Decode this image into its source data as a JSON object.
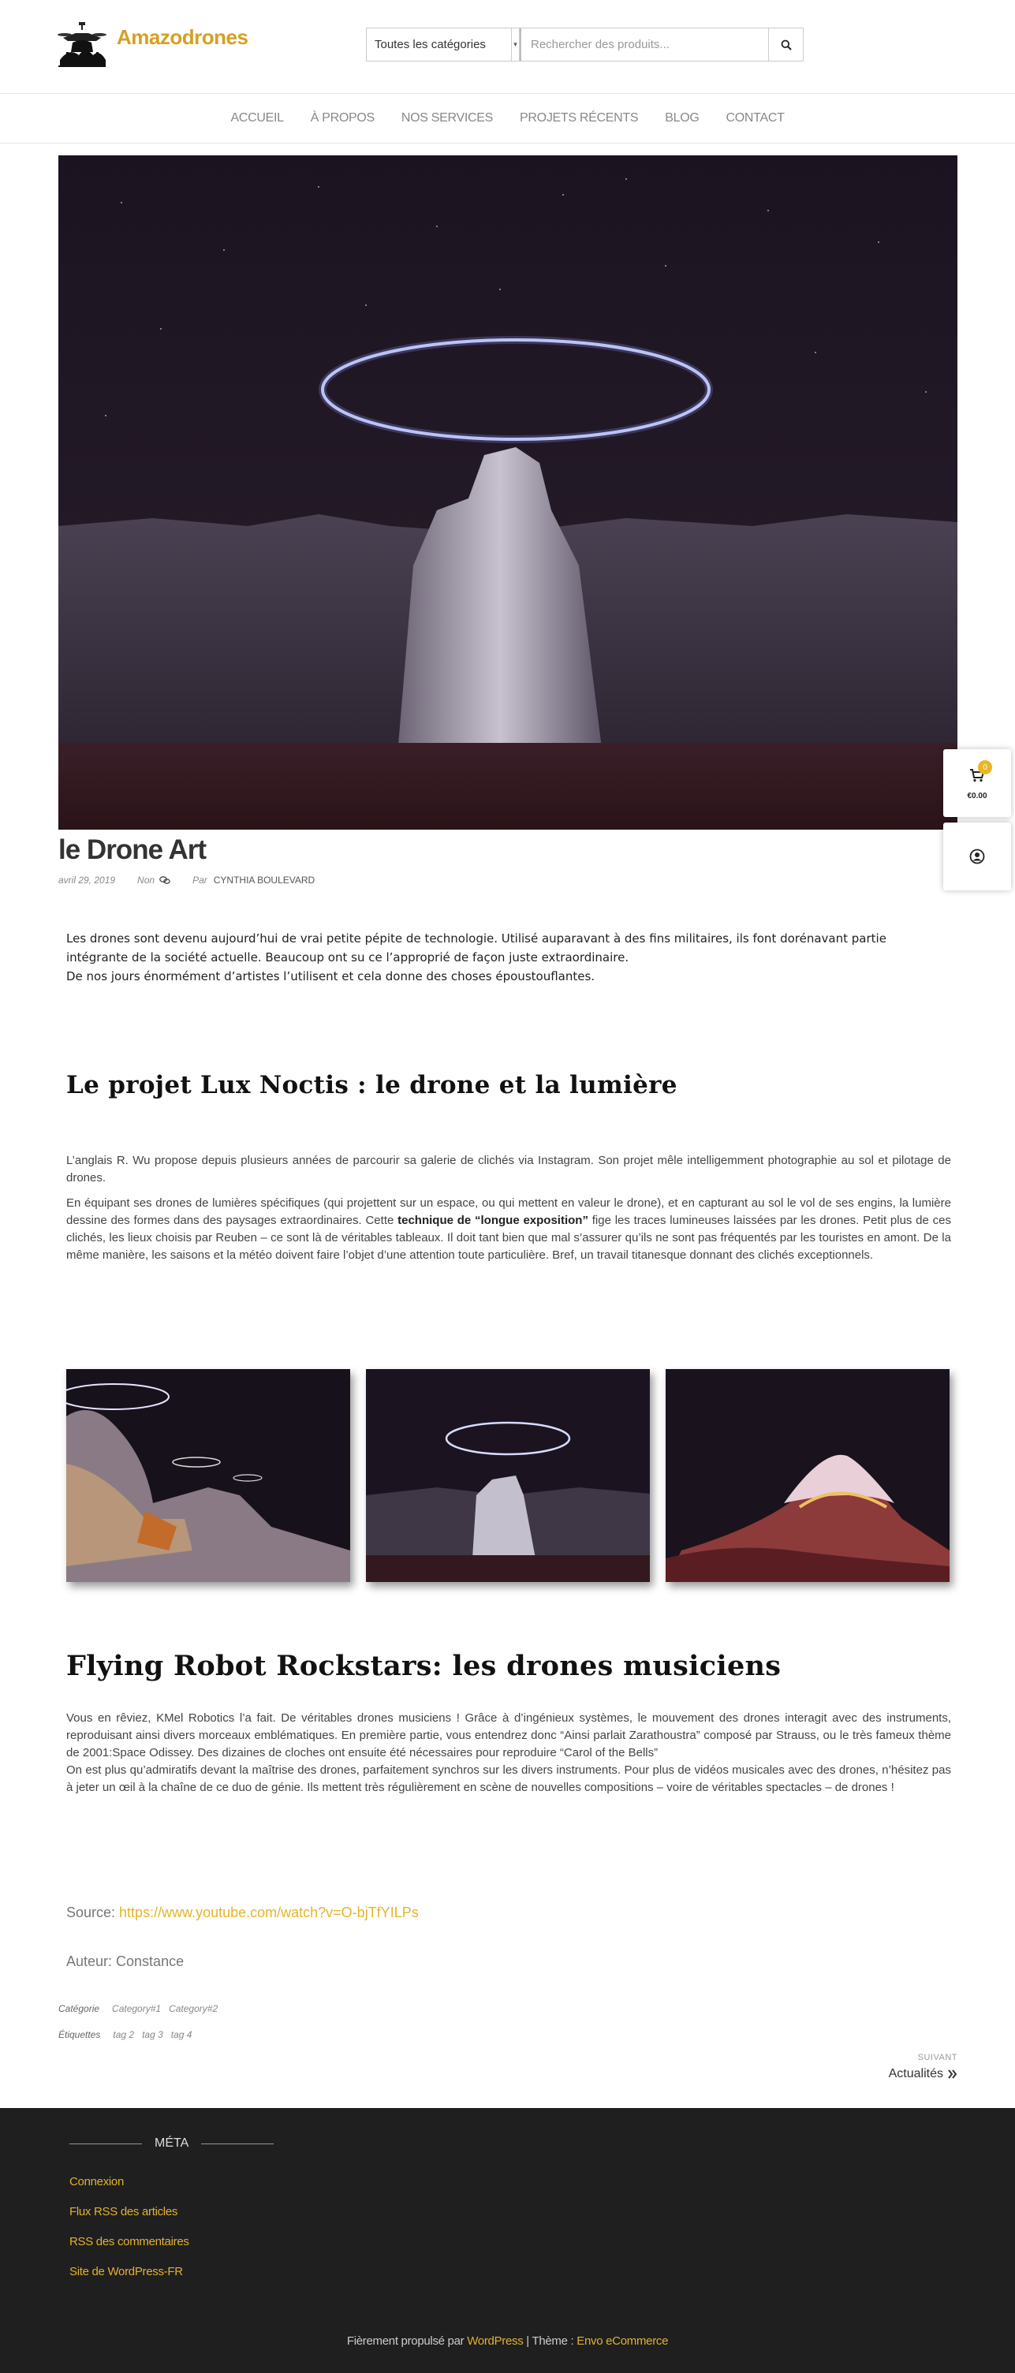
{
  "site": {
    "title": "Amazodrones"
  },
  "search": {
    "category_selected": "Toutes les catégories",
    "placeholder": "Rechercher des produits..."
  },
  "nav": {
    "items": [
      "ACCUEIL",
      "À PROPOS",
      "NOS SERVICES",
      "PROJETS RÉCENTS",
      "BLOG",
      "CONTACT"
    ]
  },
  "side": {
    "cart_count": "0",
    "cart_total": "€0.00"
  },
  "post": {
    "title": "le Drone Art",
    "date": "avril 29, 2019",
    "comments": "Non",
    "by": "Par",
    "author": "CYNTHIA BOULEVARD",
    "intro_1": "Les drones sont devenu aujourd’hui de vrai petite pépite de technologie. Utilisé auparavant à des fins militaires, ils font dorénavant partie intégrante de la société actuelle. Beaucoup ont su ce l’approprié de façon juste extraordinaire.",
    "intro_2": "De nos jours énormément d’artistes l’utilisent et cela donne des choses époustouflantes.",
    "section1_title": "Le projet Lux Noctis : le drone et la lumière",
    "section1_p1": "L’anglais R. Wu propose depuis plusieurs années de parcourir sa galerie de clichés via Instagram. Son projet mêle intelligemment photographie au sol et pilotage de drones.",
    "section1_p2_a": "En équipant ses drones de lumières spécifiques (qui projettent sur un espace, ou qui mettent en valeur le drone), et en capturant au sol le vol de ses engins, la lumière dessine des formes dans des paysages extraordinaires. Cette ",
    "section1_p2_bold": "technique de “longue exposition”",
    "section1_p2_b": " fige les traces lumineuses laissées par les drones. Petit plus de ces clichés, les lieux choisis par Reuben – ce sont là de véritables tableaux. Il doit tant bien que mal s’assurer qu’ils ne sont pas fréquentés par les touristes en amont. De la même manière, les saisons et la météo doivent faire l’objet d’une attention toute particulière. Bref, un travail titanesque donnant des clichés exceptionnels.",
    "section2_title": "Flying Robot Rockstars: les drones musiciens",
    "section2_p1": "Vous en rêviez, KMel Robotics l’a fait. De véritables drones musiciens ! Grâce à d’ingénieux systèmes, le mouvement des drones interagit avec des instruments, reproduisant ainsi divers morceaux emblématiques. En première partie, vous entendrez donc “Ainsi parlait Zarathoustra” composé par Strauss, ou le très fameux thème de 2001:Space Odissey. Des dizaines de cloches ont ensuite été nécessaires pour reproduire “Carol of the Bells”",
    "section2_p2": "On est plus qu’admiratifs devant la maîtrise des drones, parfaitement synchros sur les divers instruments. Pour plus de vidéos musicales avec des drones, n’hésitez pas à jeter un œil à la chaîne de ce duo de génie. Ils mettent très régulièrement en scène de nouvelles compositions – voire de véritables spectacles – de drones !",
    "source_label": "Source: ",
    "source_url": "https://www.youtube.com/watch?v=O-bjTfYILPs",
    "author_line": "Auteur: Constance",
    "categories_label": "Catégorie",
    "categories": [
      "Category#1",
      "Category#2"
    ],
    "tags_label": "Étiquettes",
    "tags": [
      "tag 2",
      "tag 3",
      "tag 4"
    ],
    "next_label": "SUIVANT",
    "next_title": "Actualités"
  },
  "footer": {
    "meta_title": "MÉTA",
    "links": [
      "Connexion",
      "Flux RSS des articles",
      "RSS des commentaires",
      "Site de WordPress-FR"
    ],
    "powered_prefix": "Fièrement propulsé par ",
    "powered_link": "WordPress",
    "theme_prefix": " | Thème : ",
    "theme_link": "Envo eCommerce"
  },
  "colors": {
    "accent": "#d5a023",
    "footer_bg": "#1f1f1f"
  }
}
